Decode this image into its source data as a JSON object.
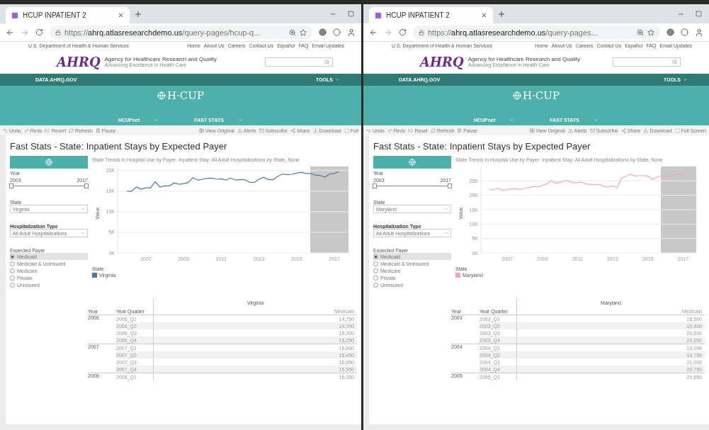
{
  "windows": [
    {
      "tab_title": "HCUP INPATIENT 2",
      "url": "https://**ahrq.atlasresearchdemo.us**/query-pages/hcup-q...",
      "gov_link": "U.S. Department of Health & Human Services",
      "top_links": [
        "Home",
        "About Us",
        "Careers",
        "Contact Us",
        "Español",
        "FAQ",
        "Email Updates"
      ],
      "logo": "AHRQ",
      "agency": "Agency for Healthcare Research and Quality",
      "tagline": "Advancing Excellence in Health Care",
      "nav_left": "DATA.AHRQ.GOV",
      "nav_right": "TOOLS",
      "banner": "H·CUP",
      "subnav": [
        "HCUPnet",
        "FAST STATS"
      ],
      "toolbar": [
        {
          "kind": "undo",
          "label": "Undo"
        },
        {
          "kind": "redo",
          "label": "Redo"
        },
        {
          "kind": "revert",
          "label": "Revert"
        },
        {
          "kind": "refresh",
          "label": "Refresh"
        },
        {
          "kind": "pause",
          "label": "Pause"
        },
        {
          "kind": "view",
          "label": "View Original"
        },
        {
          "kind": "alert",
          "label": "Alerts"
        },
        {
          "kind": "subscribe",
          "label": "Subscribe"
        },
        {
          "kind": "share",
          "label": "Share"
        },
        {
          "kind": "download",
          "label": "Download"
        },
        {
          "kind": "full",
          "label": "Full"
        }
      ],
      "page_title": "Fast Stats - State: Inpatient Stays by Expected Payer",
      "year_label": "Year",
      "year_min": "2003",
      "year_max": "2017",
      "year_slider": {
        "level": 1
      },
      "state_label": "State",
      "state_value": "Virginia",
      "hosp_label": "Hospitalization Type",
      "hosp_value": "All Adult Hospitalizations",
      "payer_label": "Expected Payer",
      "payer_options": [
        {
          "label": "Medicaid",
          "selected": true
        },
        {
          "label": "Medicaid & Uninsured",
          "selected": false
        },
        {
          "label": "Medicare",
          "selected": false
        },
        {
          "label": "Private",
          "selected": false
        },
        {
          "label": "Uninsured",
          "selected": false
        }
      ],
      "chart_title": "State Trends in Hospital Use by Payer: Inpatient Stay: All Adult Hospitalizations by State, None",
      "legend_title": "State",
      "chart_data": {
        "type": "line",
        "ylabel": "Value",
        "grid": true,
        "xlim": [
          2005.5,
          2017.75
        ],
        "ylim": [
          0,
          21000
        ],
        "xticks": [
          2007,
          2009,
          2011,
          2013,
          2015,
          2017
        ],
        "yticks": [
          {
            "value": 0,
            "label": "0K"
          },
          {
            "value": 5000,
            "label": "5K"
          },
          {
            "value": 10000,
            "label": "10K"
          },
          {
            "value": 15000,
            "label": "15K"
          },
          {
            "value": 20000,
            "label": "20K"
          }
        ],
        "x": [
          2006,
          2006.25,
          2006.5,
          2006.75,
          2007,
          2007.25,
          2007.5,
          2007.75,
          2008,
          2008.25,
          2008.5,
          2008.75,
          2009,
          2009.25,
          2009.5,
          2009.75,
          2010,
          2010.25,
          2010.5,
          2010.75,
          2011,
          2011.25,
          2011.5,
          2011.75,
          2012,
          2012.25,
          2012.5,
          2012.75,
          2013,
          2013.25,
          2013.5,
          2013.75,
          2014,
          2014.25,
          2014.5,
          2014.75,
          2015,
          2015.25,
          2015.5,
          2015.75,
          2016,
          2016.25,
          2016.5,
          2016.75,
          2017,
          2017.25
        ],
        "series": [
          {
            "name": "Virginia",
            "color": "#4e79a7",
            "values": [
              15000,
              15000,
              16000,
              15500,
              15800,
              15800,
              17300,
              16000,
              16300,
              16300,
              17000,
              16700,
              16800,
              17100,
              18300,
              17700,
              17900,
              18100,
              18200,
              17900,
              18000,
              17700,
              18200,
              17700,
              17800,
              17800,
              17200,
              17100,
              17900,
              18400,
              17800,
              17800,
              18600,
              19200,
              19000,
              19100,
              19400,
              19600,
              19300,
              19300,
              18900,
              18800,
              18400,
              19200,
              19300,
              19800
            ]
          }
        ]
      },
      "table": {
        "header": "Virginia",
        "columns": [
          "Year",
          "Year Quarter",
          "Medicaid"
        ],
        "groups": [
          {
            "year": "2006",
            "rows": [
              {
                "quarter": "2006_Q1",
                "value": "14,750"
              },
              {
                "quarter": "2006_Q2",
                "value": "14,700"
              },
              {
                "quarter": "2006_Q3",
                "value": "15,900"
              },
              {
                "quarter": "2006_Q4",
                "value": "15,250"
              }
            ]
          },
          {
            "year": "2007",
            "rows": [
              {
                "quarter": "2007_Q1",
                "value": "15,600"
              },
              {
                "quarter": "2007_Q2",
                "value": "15,450"
              },
              {
                "quarter": "2007_Q3",
                "value": "16,050"
              },
              {
                "quarter": "2007_Q4",
                "value": "15,550"
              }
            ]
          },
          {
            "year": "2008",
            "rows": [
              {
                "quarter": "2008_Q1",
                "value": "15,350"
              }
            ]
          }
        ]
      }
    },
    {
      "tab_title": "HCUP INPATIENT 2",
      "url": "https://**ahrq.atlasresearchdemo.us**/query-pages...",
      "gov_link": "U.S. Department of Health & Human Services",
      "top_links": [
        "Home",
        "About Us",
        "Careers",
        "Contact Us",
        "Español",
        "FAQ",
        "Email Updates"
      ],
      "logo": "AHRQ",
      "agency": "Agency for Healthcare Research and Quality",
      "tagline": "Advancing Excellence in Health Care",
      "nav_left": "DATA.AHRQ.GOV",
      "nav_right": "TOOLS",
      "banner": "H·CUP",
      "subnav": [
        "HCUPnet",
        "FAST STATS"
      ],
      "toolbar": [
        {
          "kind": "undo",
          "label": "Undo"
        },
        {
          "kind": "redo",
          "label": "Redo"
        },
        {
          "kind": "revert",
          "label": "Reset"
        },
        {
          "kind": "refresh",
          "label": "Refresh"
        },
        {
          "kind": "pause",
          "label": "Pause"
        },
        {
          "kind": "view",
          "label": "View Original"
        },
        {
          "kind": "alert",
          "label": "Alerts"
        },
        {
          "kind": "subscribe",
          "label": "Subscribe"
        },
        {
          "kind": "share",
          "label": "Share"
        },
        {
          "kind": "download",
          "label": "Download"
        },
        {
          "kind": "full",
          "label": "Full Screen"
        }
      ],
      "page_title": "Fast Stats - State: Inpatient Stays by Expected Payer",
      "year_label": "Year",
      "year_min": "2003",
      "year_max": "2017",
      "year_slider": {
        "level": 1
      },
      "state_label": "State",
      "state_value": "Maryland",
      "hosp_label": "Hospitalization Type",
      "hosp_value": "All Adult Hospitalizations",
      "payer_label": "Expected Payer",
      "payer_options": [
        {
          "label": "Medicaid",
          "selected": true
        },
        {
          "label": "Medicaid & Uninsured",
          "selected": false
        },
        {
          "label": "Medicare",
          "selected": false
        },
        {
          "label": "Private",
          "selected": false
        },
        {
          "label": "Uninsured",
          "selected": false
        }
      ],
      "chart_title": "State Trends in Hospital Use by Payer: Inpatient Stay: All Adult Hospitalizations by State, None",
      "legend_title": "State",
      "chart_data": {
        "type": "line",
        "ylabel": "Value",
        "grid": true,
        "xlim": [
          2005.5,
          2017.75
        ],
        "ylim": [
          0,
          30000
        ],
        "xticks": [
          2007,
          2009,
          2011,
          2013,
          2015,
          2017
        ],
        "yticks": [
          {
            "value": 0,
            "label": "0K"
          },
          {
            "value": 5000,
            "label": "5K"
          },
          {
            "value": 10000,
            "label": "10K"
          },
          {
            "value": 15000,
            "label": "15K"
          },
          {
            "value": 20000,
            "label": "20K"
          },
          {
            "value": 25000,
            "label": "25K"
          }
        ],
        "x": [
          2006,
          2006.25,
          2006.5,
          2006.75,
          2007,
          2007.25,
          2007.5,
          2007.75,
          2008,
          2008.25,
          2008.5,
          2008.75,
          2009,
          2009.25,
          2009.5,
          2009.75,
          2010,
          2010.25,
          2010.5,
          2010.75,
          2011,
          2011.25,
          2011.5,
          2011.75,
          2012,
          2012.25,
          2012.5,
          2012.75,
          2013,
          2013.25,
          2013.5,
          2013.75,
          2014,
          2014.25,
          2014.5,
          2014.75,
          2015,
          2015.25,
          2015.5,
          2015.75,
          2016,
          2016.25,
          2016.5,
          2016.75,
          2017
        ],
        "series": [
          {
            "name": "Maryland",
            "color": "#f4a6b7",
            "values": [
              21800,
              22000,
              22400,
              21700,
              22000,
              22200,
              22300,
              22000,
              22500,
              22700,
              23100,
              22900,
              23400,
              24000,
              25000,
              24200,
              24500,
              25000,
              24900,
              24300,
              24400,
              24600,
              23900,
              23800,
              23600,
              23800,
              23000,
              22900,
              23200,
              22600,
              26000,
              26500,
              27400,
              26700,
              26800,
              26800,
              26700,
              25500,
              26200,
              26800,
              26300,
              26500,
              27000,
              27500,
              26600
            ]
          }
        ]
      },
      "table": {
        "header": "Maryland",
        "columns": [
          "Year",
          "Year Quarter",
          "Medicaid"
        ],
        "groups": [
          {
            "year": "2003",
            "rows": [
              {
                "quarter": "2003_Q1",
                "value": "18,500"
              },
              {
                "quarter": "2003_Q2",
                "value": "19,400"
              },
              {
                "quarter": "2003_Q3",
                "value": "20,500"
              },
              {
                "quarter": "2003_Q4",
                "value": "20,050"
              }
            ]
          },
          {
            "year": "2004",
            "rows": [
              {
                "quarter": "2004_Q1",
                "value": "19,000"
              },
              {
                "quarter": "2004_Q2",
                "value": "19,750"
              },
              {
                "quarter": "2004_Q3",
                "value": "21,000"
              },
              {
                "quarter": "2004_Q4",
                "value": "20,750"
              }
            ]
          },
          {
            "year": "2005",
            "rows": [
              {
                "quarter": "2005_Q1",
                "value": "20,650"
              }
            ]
          }
        ]
      }
    }
  ]
}
